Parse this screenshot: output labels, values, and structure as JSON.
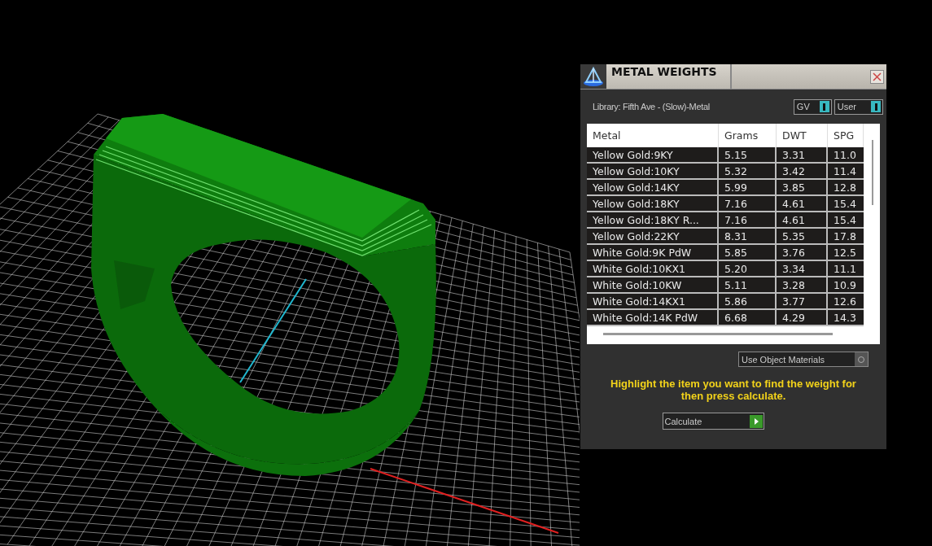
{
  "panel": {
    "title": "METAL WEIGHTS",
    "library": "Library: Fifth Ave - (Slow)-Metal",
    "toggles": [
      {
        "label": "GV",
        "on": true
      },
      {
        "label": "User",
        "on": true
      }
    ],
    "table": {
      "columns": [
        "Metal",
        "Grams",
        "DWT",
        "SPG"
      ],
      "rows": [
        [
          "Yellow Gold:9KY",
          "5.15",
          "3.31",
          "11.0"
        ],
        [
          "Yellow Gold:10KY",
          "5.32",
          "3.42",
          "11.4"
        ],
        [
          "Yellow Gold:14KY",
          "5.99",
          "3.85",
          "12.8"
        ],
        [
          "Yellow Gold:18KY",
          "7.16",
          "4.61",
          "15.4"
        ],
        [
          "Yellow Gold:18KY R...",
          "7.16",
          "4.61",
          "15.4"
        ],
        [
          "Yellow Gold:22KY",
          "8.31",
          "5.35",
          "17.8"
        ],
        [
          "White Gold:9K PdW",
          "5.85",
          "3.76",
          "12.5"
        ],
        [
          "White Gold:10KX1",
          "5.20",
          "3.34",
          "11.1"
        ],
        [
          "White Gold:10KW",
          "5.11",
          "3.28",
          "10.9"
        ],
        [
          "White Gold:14KX1",
          "5.86",
          "3.77",
          "12.6"
        ],
        [
          "White Gold:14K PdW",
          "6.68",
          "4.29",
          "14.3"
        ]
      ]
    },
    "option": {
      "label": "Use Object Materials"
    },
    "hint": "Highlight the item you want to find the weight for then press calculate.",
    "button": "Calculate"
  }
}
